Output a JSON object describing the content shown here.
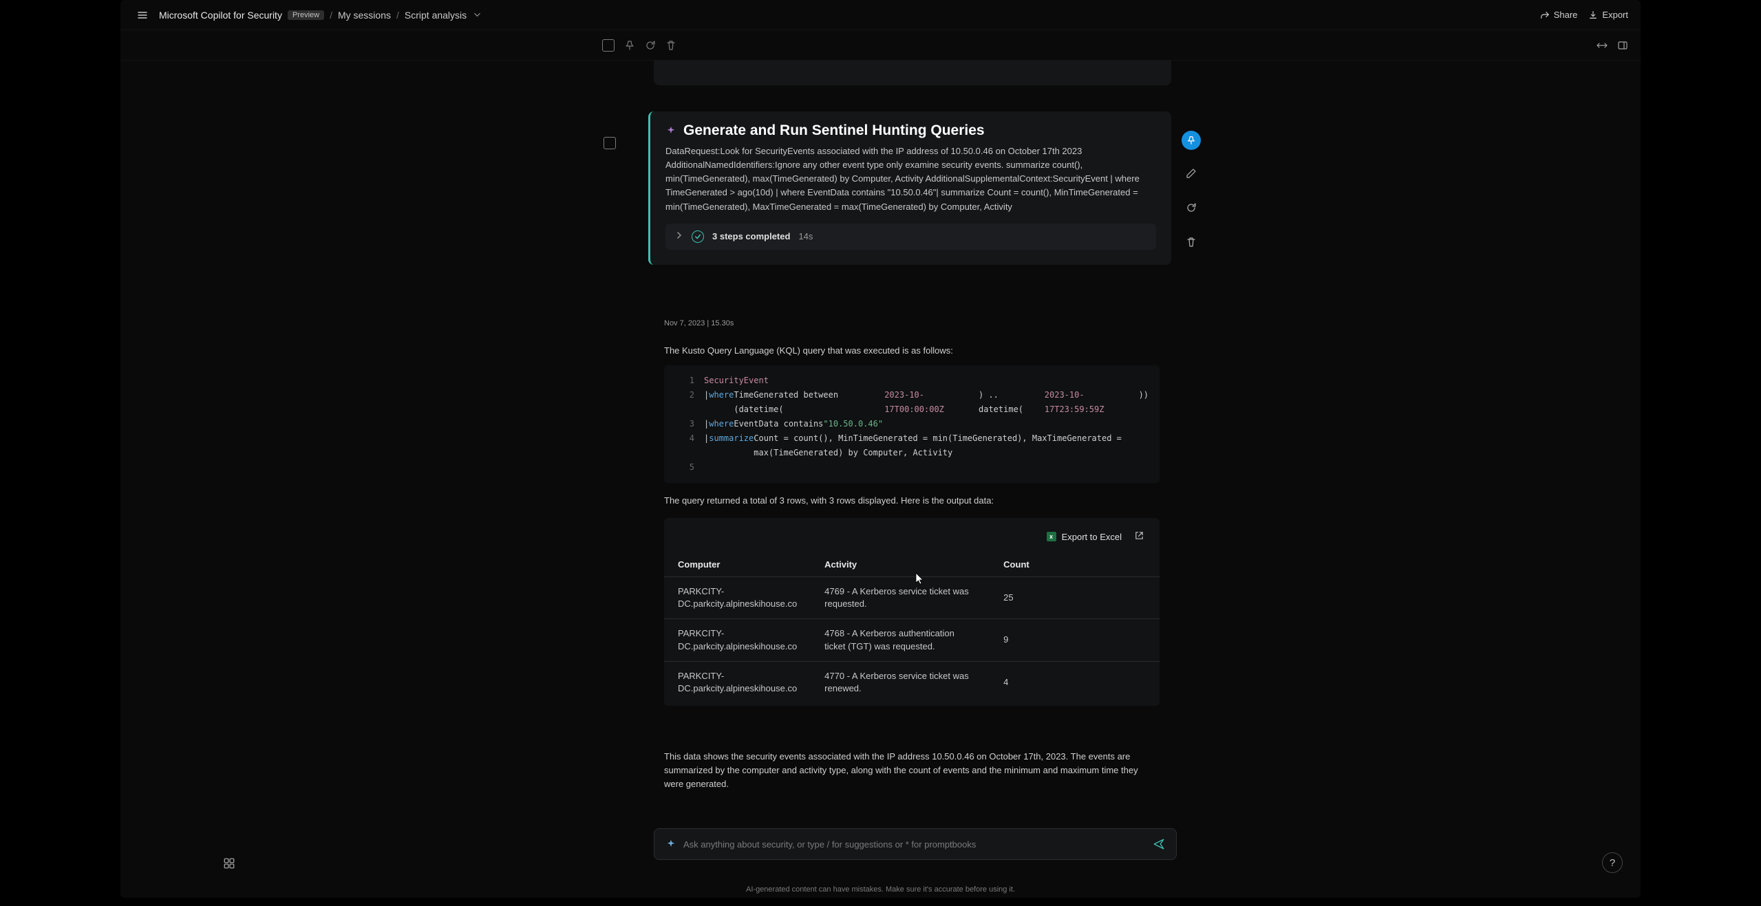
{
  "breadcrumb": {
    "app": "Microsoft Copilot for Security",
    "badge": "Preview",
    "sessions": "My sessions",
    "current": "Script analysis"
  },
  "topbar": {
    "share": "Share",
    "export": "Export"
  },
  "card": {
    "title": "Generate and Run Sentinel Hunting Queries",
    "description": "DataRequest:Look for SecurityEvents associated with the IP address of 10.50.0.46 on October 17th 2023 AdditionalNamedIdentifiers:Ignore any other event type only examine security events. summarize count(), min(TimeGenerated), max(TimeGenerated) by Computer, Activity AdditionalSupplementalContext:SecurityEvent | where TimeGenerated > ago(10d) | where EventData contains \"10.50.0.46\"| summarize Count = count(), MinTimeGenerated = min(TimeGenerated), MaxTimeGenerated = max(TimeGenerated) by Computer, Activity",
    "steps_label": "3 steps completed",
    "steps_time": "14s"
  },
  "timestamp": "Nov 7, 2023  |  15.30s",
  "body": {
    "p1": "The Kusto Query Language (KQL) query that was executed is as follows:",
    "p2": "The query returned a total of 3 rows, with 3 rows displayed. Here is the output data:",
    "p3": "This data shows the security events associated with the IP address 10.50.0.46 on October 17th, 2023. The events are summarized by the computer and activity type, along with the count of events and the minimum and maximum time they were generated."
  },
  "code": {
    "l1_ident": "SecurityEvent",
    "l2_kw": "where",
    "l2_rest_a": "TimeGenerated between (datetime(",
    "l2_dt1": "2023-10-17T00:00:00Z",
    "l2_rest_b": ") .. datetime(",
    "l2_dt2": "2023-10-17T23:59:59Z",
    "l2_rest_c": "))",
    "l3_kw": "where",
    "l3_rest_a": "EventData contains ",
    "l3_str": "\"10.50.0.46\"",
    "l4_kw": "summarize",
    "l4_rest": "Count = count(), MinTimeGenerated = min(TimeGenerated), MaxTimeGenerated = max(TimeGenerated) by Computer, Activity"
  },
  "export_label": "Export to Excel",
  "table": {
    "headers": {
      "c1": "Computer",
      "c2": "Activity",
      "c3": "Count"
    },
    "rows": [
      {
        "computer": "PARKCITY-DC.parkcity.alpineskihouse.co",
        "activity": "4769 - A Kerberos service ticket was requested.",
        "count": "25"
      },
      {
        "computer": "PARKCITY-DC.parkcity.alpineskihouse.co",
        "activity": "4768 - A Kerberos authentication ticket (TGT) was requested.",
        "count": "9"
      },
      {
        "computer": "PARKCITY-DC.parkcity.alpineskihouse.co",
        "activity": "4770 - A Kerberos service ticket was renewed.",
        "count": "4"
      }
    ]
  },
  "prompt": {
    "placeholder": "Ask anything about security, or type / for suggestions or * for promptbooks"
  },
  "footer": "AI-generated content can have mistakes. Make sure it's accurate before using it."
}
